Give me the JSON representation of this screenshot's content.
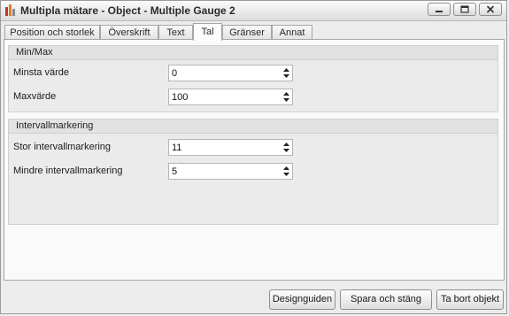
{
  "window": {
    "title": "Multipla mätare - Object - Multiple Gauge 2",
    "icon": "gauge-app-icon"
  },
  "tabs": [
    {
      "label": "Position och storlek",
      "active": false
    },
    {
      "label": "Överskrift",
      "active": false
    },
    {
      "label": "Text",
      "active": false
    },
    {
      "label": "Tal",
      "active": true
    },
    {
      "label": "Gränser",
      "active": false
    },
    {
      "label": "Annat",
      "active": false
    }
  ],
  "groups": {
    "minmax": {
      "title": "Min/Max",
      "fields": [
        {
          "label": "Minsta värde",
          "value": "0"
        },
        {
          "label": "Maxvärde",
          "value": "100"
        }
      ]
    },
    "interval": {
      "title": "Intervallmarkering",
      "fields": [
        {
          "label": "Stor intervallmarkering",
          "value": "11"
        },
        {
          "label": "Mindre intervallmarkering",
          "value": "5"
        }
      ]
    }
  },
  "footer": {
    "design_label": "Designguiden",
    "save_label": "Spara och stäng",
    "delete_label": "Ta bort objekt"
  }
}
